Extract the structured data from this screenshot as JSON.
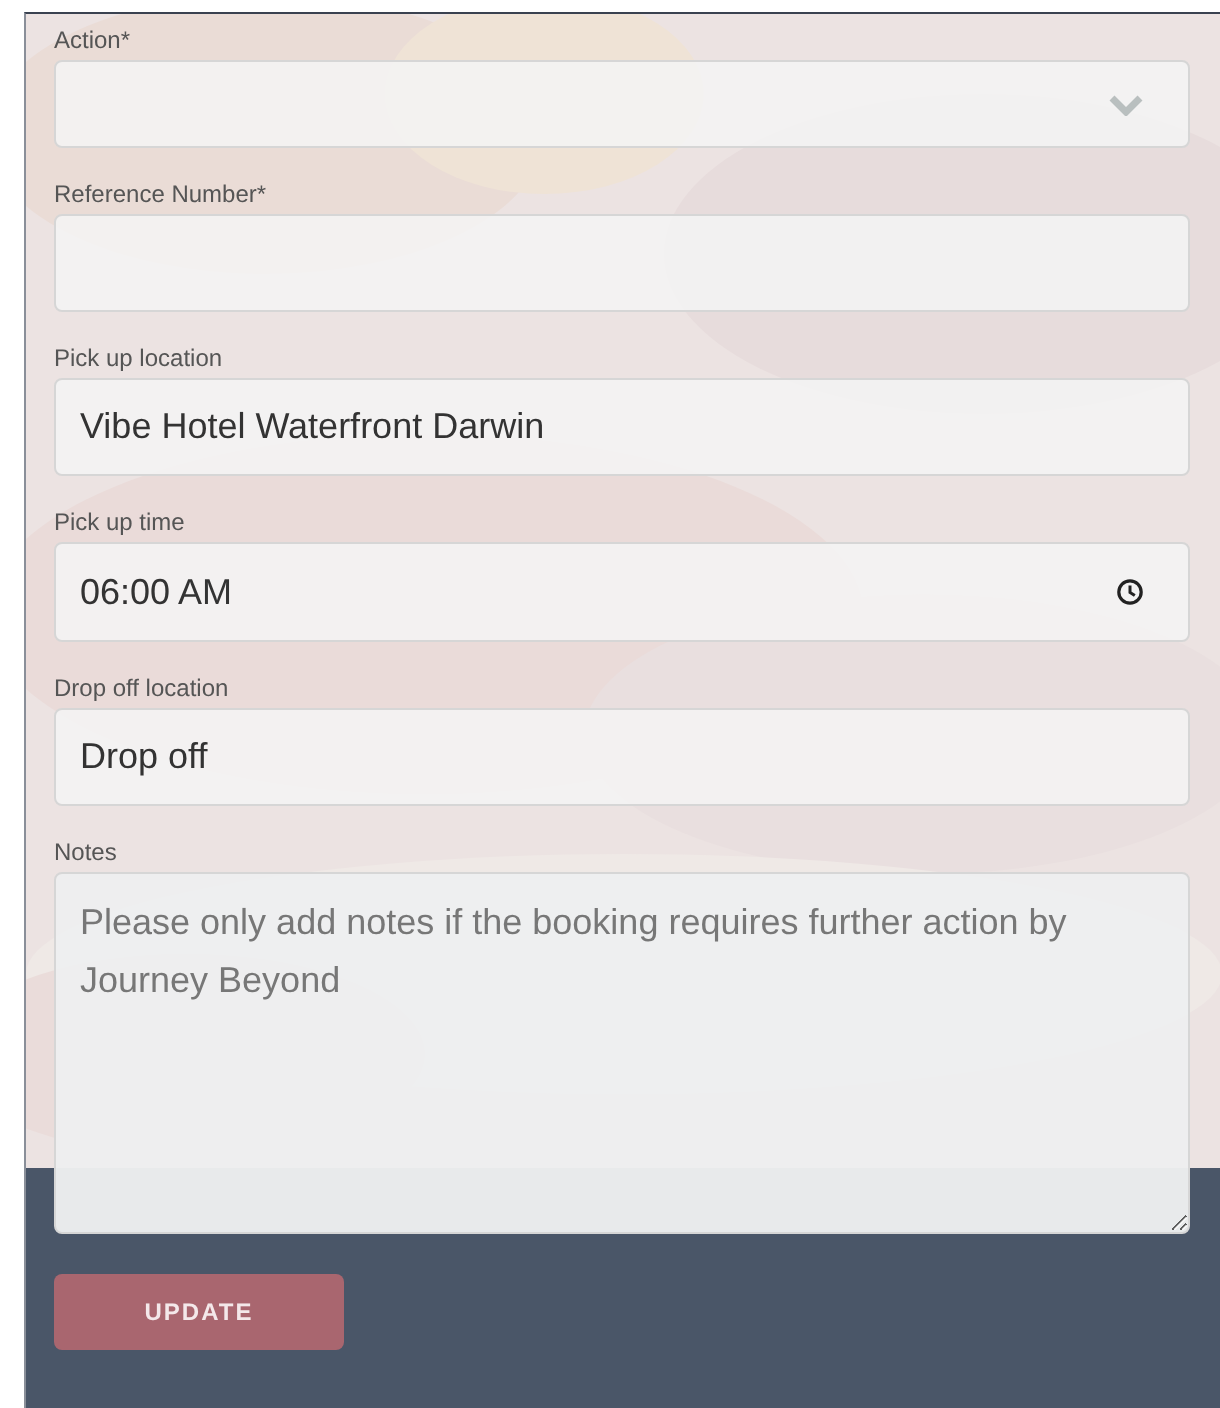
{
  "fields": [
    {
      "kind": "select",
      "label": "Action*"
    },
    {
      "kind": "text",
      "label": "Reference Number*"
    },
    {
      "kind": "text",
      "label": "Pick up location",
      "value": "Vibe Hotel Waterfront Darwin"
    },
    {
      "kind": "time",
      "label": "Pick up time",
      "value": "06:00 AM"
    },
    {
      "kind": "text",
      "label": "Drop off location",
      "value": "Drop off"
    },
    {
      "kind": "textarea",
      "label": "Notes",
      "placeholder": "Please only add notes if the booking requires further action by Journey Beyond"
    }
  ],
  "button": "UPDATE"
}
